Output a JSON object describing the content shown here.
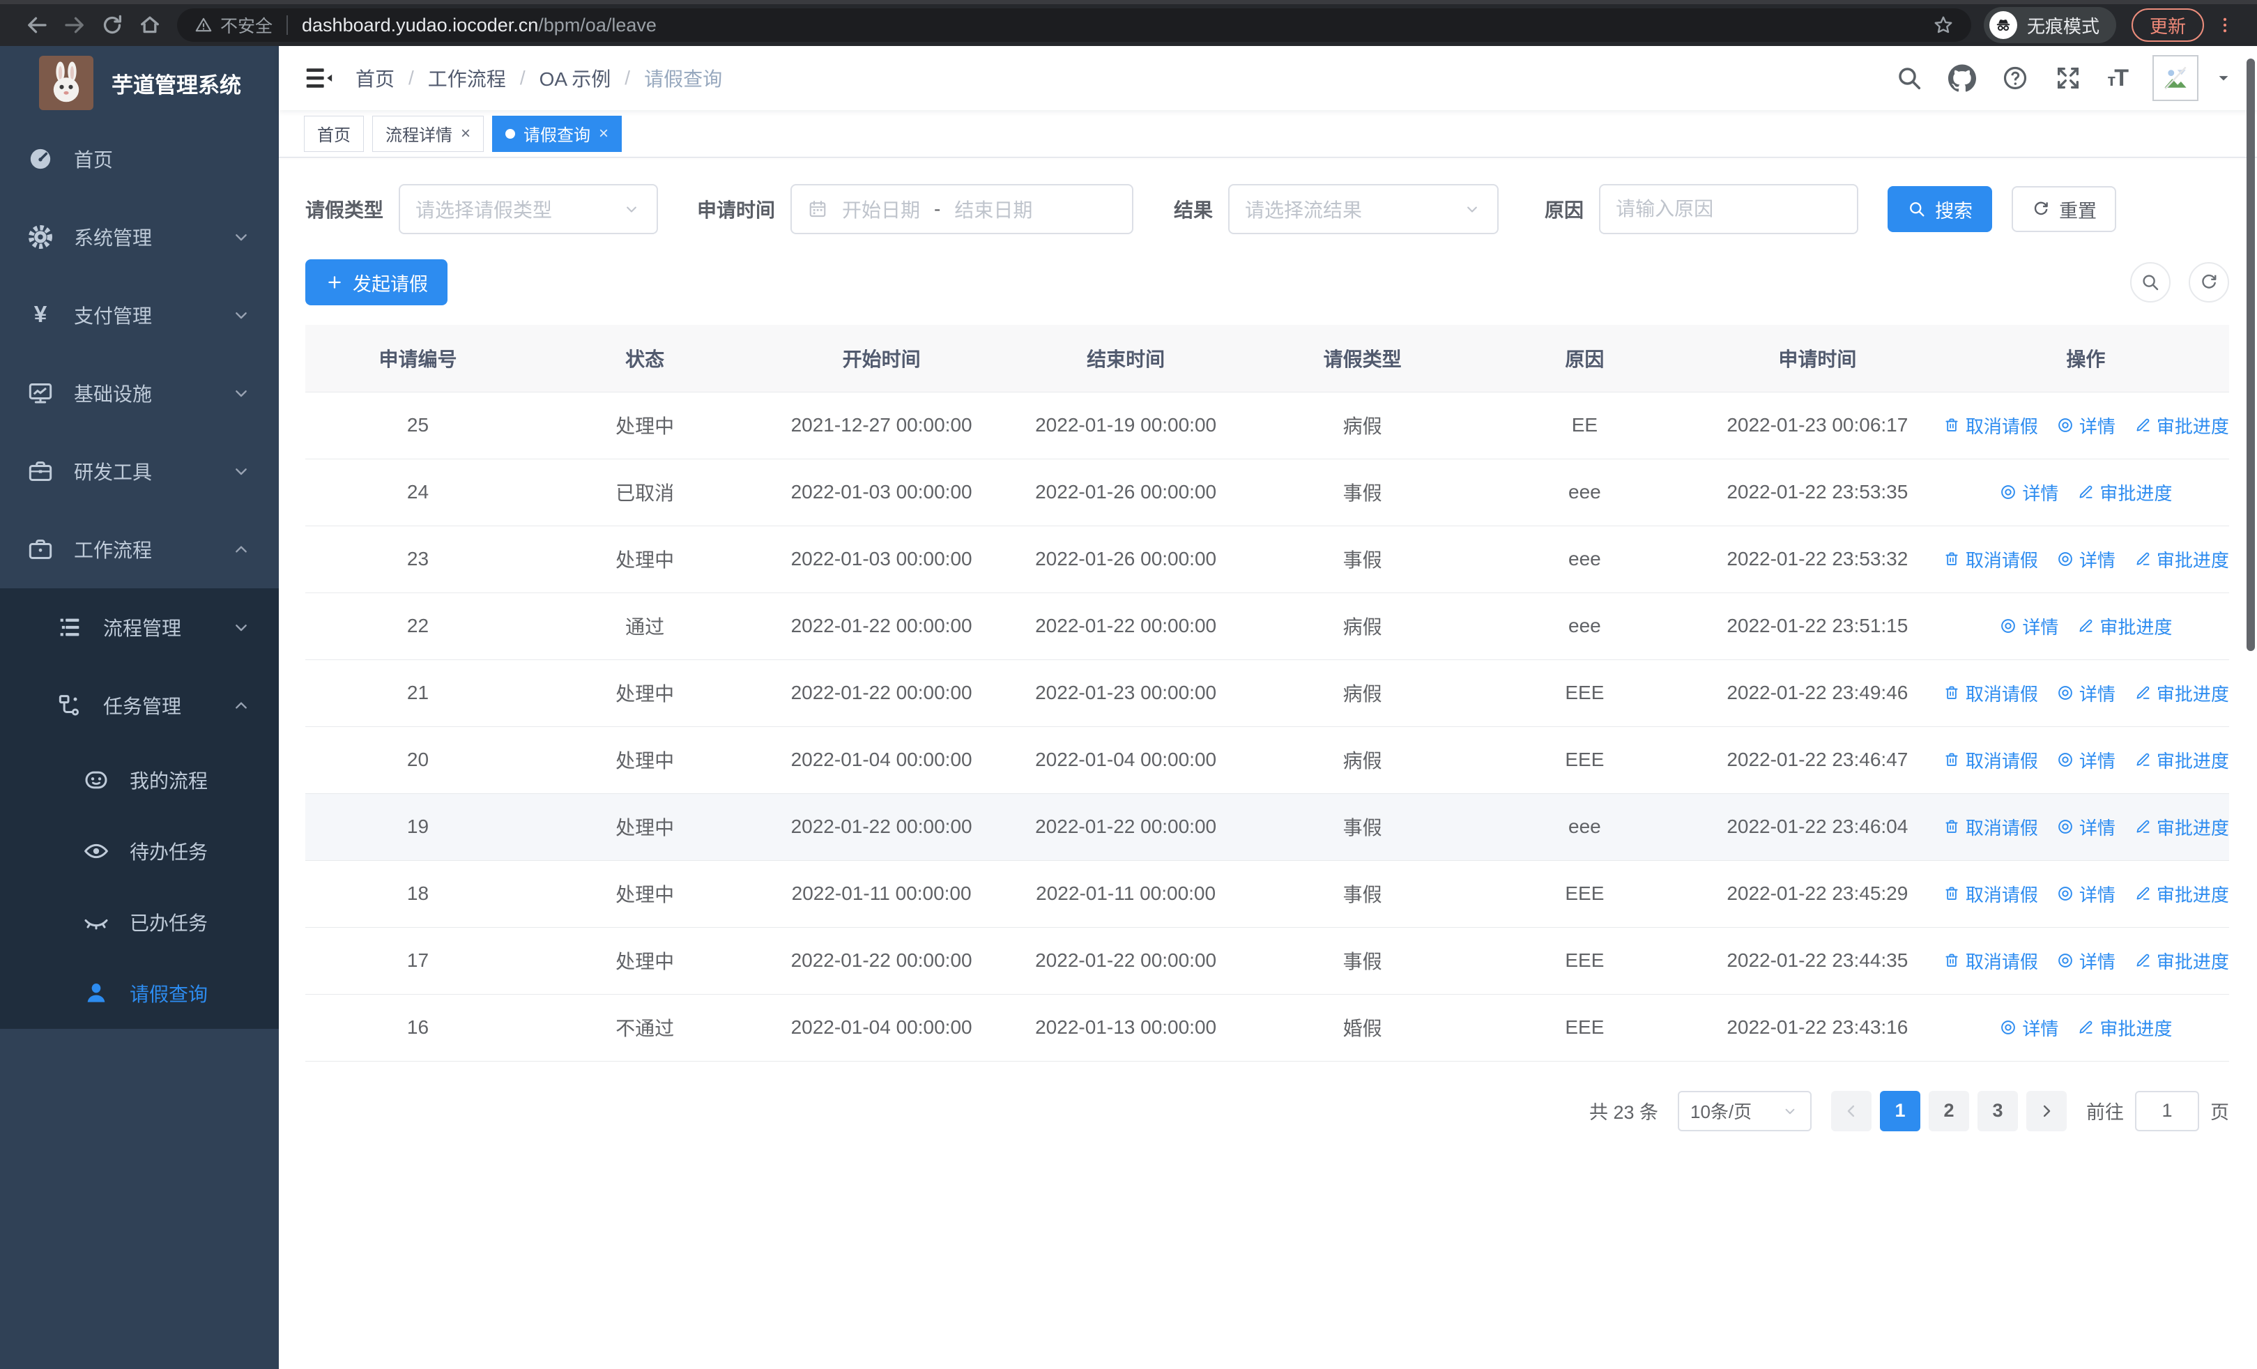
{
  "browser": {
    "security_label": "不安全",
    "url_host": "dashboard.yudao.iocoder.cn",
    "url_path": "/bpm/oa/leave",
    "incognito_label": "无痕模式",
    "update_button": "更新"
  },
  "sidebar": {
    "title": "芋道管理系统",
    "menu": [
      {
        "key": "home",
        "label": "首页",
        "icon": "dashboard-icon",
        "level": 1
      },
      {
        "key": "system-management",
        "label": "系统管理",
        "icon": "gear-icon",
        "level": 1,
        "chevron": "down"
      },
      {
        "key": "payment-management",
        "label": "支付管理",
        "icon": "yen-icon",
        "level": 1,
        "chevron": "down"
      },
      {
        "key": "infrastructure",
        "label": "基础设施",
        "icon": "monitor-icon",
        "level": 1,
        "chevron": "down"
      },
      {
        "key": "dev-tools",
        "label": "研发工具",
        "icon": "toolbox-icon",
        "level": 1,
        "chevron": "down"
      },
      {
        "key": "workflow",
        "label": "工作流程",
        "icon": "briefcase-icon",
        "level": 1,
        "chevron": "up"
      },
      {
        "key": "process-management",
        "label": "流程管理",
        "icon": "list-tree-icon",
        "level": 2,
        "chevron": "down",
        "inSubmenu": true
      },
      {
        "key": "task-management",
        "label": "任务管理",
        "icon": "nodes-icon",
        "level": 2,
        "chevron": "up",
        "inSubmenu": true
      },
      {
        "key": "my-process",
        "label": "我的流程",
        "icon": "robot-face-icon",
        "level": 3,
        "inSubmenu": true
      },
      {
        "key": "todo-tasks",
        "label": "待办任务",
        "icon": "eye-open-icon",
        "level": 3,
        "inSubmenu": true
      },
      {
        "key": "done-tasks",
        "label": "已办任务",
        "icon": "eye-closed-icon",
        "level": 3,
        "inSubmenu": true
      },
      {
        "key": "leave-query",
        "label": "请假查询",
        "icon": "person-icon",
        "level": 3,
        "inSubmenu": true,
        "active": true
      }
    ]
  },
  "header": {
    "breadcrumb": [
      "首页",
      "工作流程",
      "OA 示例",
      "请假查询"
    ]
  },
  "tabs": [
    {
      "key": "home",
      "label": "首页",
      "closable": false,
      "active": false
    },
    {
      "key": "process-detail",
      "label": "流程详情",
      "closable": true,
      "active": false
    },
    {
      "key": "leave-query",
      "label": "请假查询",
      "closable": true,
      "active": true
    }
  ],
  "filters": {
    "leave_type_label": "请假类型",
    "leave_type_placeholder": "请选择请假类型",
    "apply_time_label": "申请时间",
    "start_date_placeholder": "开始日期",
    "date_separator": "-",
    "end_date_placeholder": "结束日期",
    "result_label": "结果",
    "result_placeholder": "请选择流结果",
    "reason_label": "原因",
    "reason_placeholder": "请输入原因",
    "search_button": "搜索",
    "reset_button": "重置"
  },
  "toolbar": {
    "create_button": "发起请假"
  },
  "table": {
    "columns": [
      "申请编号",
      "状态",
      "开始时间",
      "结束时间",
      "请假类型",
      "原因",
      "申请时间",
      "操作"
    ],
    "action_labels": {
      "cancel": "取消请假",
      "detail": "详情",
      "progress": "审批进度"
    },
    "rows": [
      {
        "id": "25",
        "status": "处理中",
        "start": "2021-12-27 00:00:00",
        "end": "2022-01-19 00:00:00",
        "type": "病假",
        "reason": "EE",
        "apply_time": "2022-01-23 00:06:17",
        "actions": [
          "cancel",
          "detail",
          "progress"
        ],
        "highlighted": false
      },
      {
        "id": "24",
        "status": "已取消",
        "start": "2022-01-03 00:00:00",
        "end": "2022-01-26 00:00:00",
        "type": "事假",
        "reason": "eee",
        "apply_time": "2022-01-22 23:53:35",
        "actions": [
          "detail",
          "progress"
        ],
        "highlighted": false
      },
      {
        "id": "23",
        "status": "处理中",
        "start": "2022-01-03 00:00:00",
        "end": "2022-01-26 00:00:00",
        "type": "事假",
        "reason": "eee",
        "apply_time": "2022-01-22 23:53:32",
        "actions": [
          "cancel",
          "detail",
          "progress"
        ],
        "highlighted": false
      },
      {
        "id": "22",
        "status": "通过",
        "start": "2022-01-22 00:00:00",
        "end": "2022-01-22 00:00:00",
        "type": "病假",
        "reason": "eee",
        "apply_time": "2022-01-22 23:51:15",
        "actions": [
          "detail",
          "progress"
        ],
        "highlighted": false
      },
      {
        "id": "21",
        "status": "处理中",
        "start": "2022-01-22 00:00:00",
        "end": "2022-01-23 00:00:00",
        "type": "病假",
        "reason": "EEE",
        "apply_time": "2022-01-22 23:49:46",
        "actions": [
          "cancel",
          "detail",
          "progress"
        ],
        "highlighted": false
      },
      {
        "id": "20",
        "status": "处理中",
        "start": "2022-01-04 00:00:00",
        "end": "2022-01-04 00:00:00",
        "type": "病假",
        "reason": "EEE",
        "apply_time": "2022-01-22 23:46:47",
        "actions": [
          "cancel",
          "detail",
          "progress"
        ],
        "highlighted": false
      },
      {
        "id": "19",
        "status": "处理中",
        "start": "2022-01-22 00:00:00",
        "end": "2022-01-22 00:00:00",
        "type": "事假",
        "reason": "eee",
        "apply_time": "2022-01-22 23:46:04",
        "actions": [
          "cancel",
          "detail",
          "progress"
        ],
        "highlighted": true
      },
      {
        "id": "18",
        "status": "处理中",
        "start": "2022-01-11 00:00:00",
        "end": "2022-01-11 00:00:00",
        "type": "事假",
        "reason": "EEE",
        "apply_time": "2022-01-22 23:45:29",
        "actions": [
          "cancel",
          "detail",
          "progress"
        ],
        "highlighted": false
      },
      {
        "id": "17",
        "status": "处理中",
        "start": "2022-01-22 00:00:00",
        "end": "2022-01-22 00:00:00",
        "type": "事假",
        "reason": "EEE",
        "apply_time": "2022-01-22 23:44:35",
        "actions": [
          "cancel",
          "detail",
          "progress"
        ],
        "highlighted": false
      },
      {
        "id": "16",
        "status": "不通过",
        "start": "2022-01-04 00:00:00",
        "end": "2022-01-13 00:00:00",
        "type": "婚假",
        "reason": "EEE",
        "apply_time": "2022-01-22 23:43:16",
        "actions": [
          "detail",
          "progress"
        ],
        "highlighted": false
      }
    ]
  },
  "pagination": {
    "total_text": "共 23 条",
    "page_size": "10条/页",
    "pages": [
      "1",
      "2",
      "3"
    ],
    "active_page": "1",
    "goto_label": "前往",
    "goto_value": "1",
    "page_unit": "页"
  },
  "colors": {
    "accent": "#2d8cf0",
    "sidebar_bg": "#304156",
    "submenu_bg": "#1f2d3d"
  }
}
